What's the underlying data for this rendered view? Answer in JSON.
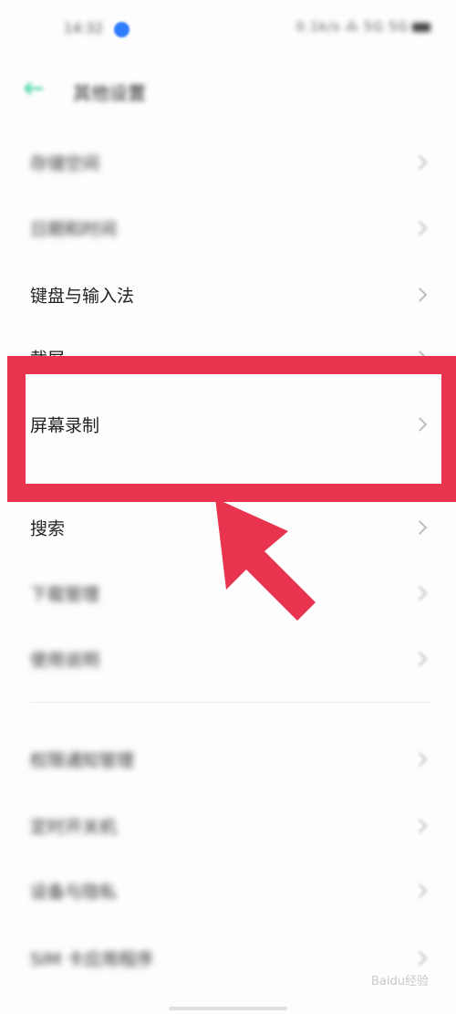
{
  "status_bar": {
    "time": "14:32",
    "right_text": "0.1k/s ⁂ 5G 5G"
  },
  "header": {
    "title": "其他设置"
  },
  "menu": {
    "items": [
      {
        "label": "存储空间",
        "blurred": true
      },
      {
        "label": "日期和时间",
        "blurred": true
      },
      {
        "label": "键盘与输入法",
        "blurred": false
      },
      {
        "label": "截屏",
        "blurred": false
      },
      {
        "label": "屏幕录制",
        "blurred": false,
        "highlighted": true
      },
      {
        "label": "搜索",
        "blurred": false
      },
      {
        "label": "下载管理",
        "blurred": true
      },
      {
        "label": "使用说明",
        "blurred": true
      },
      {
        "label": "权限通知管理",
        "blurred": true
      },
      {
        "label": "定时开关机",
        "blurred": true
      },
      {
        "label": "设备与隐私",
        "blurred": true
      },
      {
        "label": "SIM 卡应用程序",
        "blurred": true
      }
    ]
  },
  "watermark": "Baidu经验",
  "colors": {
    "highlight": "#e8344e",
    "status_dot": "#2f7dff",
    "back_icon": "#3ad29f"
  }
}
